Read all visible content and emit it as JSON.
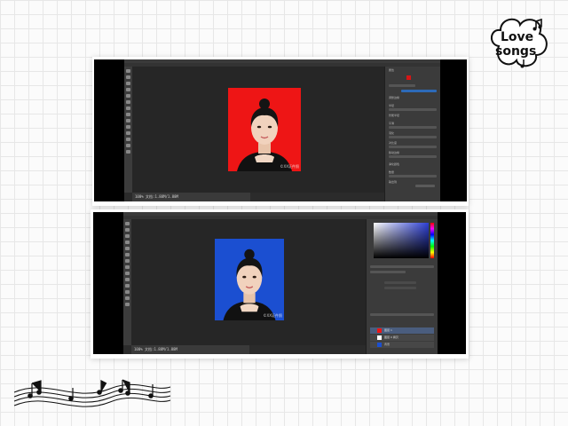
{
  "decor": {
    "logo_line1": "Love",
    "logo_line2": "songs",
    "logo_color": "#111111"
  },
  "top_screenshot": {
    "app": "Photoshop",
    "background_color": "#ee1515",
    "panel_header": "属性",
    "status_text": "100% 文档:1.88M/1.88M",
    "watermark": "©XX证件照",
    "panel": {
      "rows": [
        "调整边缘",
        "半径",
        "智能半径",
        "平滑",
        "羽化",
        "对比度",
        "移动边缘",
        "净化颜色",
        "数量",
        "输出到"
      ]
    }
  },
  "bottom_screenshot": {
    "app": "Photoshop",
    "background_color": "#1b4fd1",
    "status_text": "100% 文档:1.88M/1.88M",
    "watermark": "©XX证件照",
    "color_panel": {
      "picker_hue": "#2d3fd4"
    },
    "layers": [
      {
        "name": "图层 1",
        "thumb_color": "#ee1515"
      },
      {
        "name": "图层 0 拷贝",
        "thumb_color": "#ffffff"
      },
      {
        "name": "背景",
        "thumb_color": "#1b4fd1"
      }
    ]
  }
}
